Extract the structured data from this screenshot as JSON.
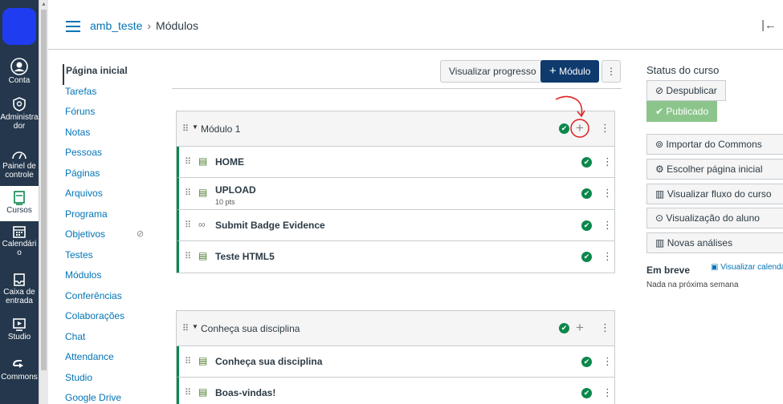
{
  "global_nav": {
    "items": [
      {
        "label": "Conta",
        "icon": "account-icon"
      },
      {
        "label": "Administrador",
        "icon": "admin-icon"
      },
      {
        "label": "Painel de controle",
        "icon": "dashboard-icon"
      },
      {
        "label": "Cursos",
        "icon": "courses-icon"
      },
      {
        "label": "Calendário",
        "icon": "calendar-icon"
      },
      {
        "label": "Caixa de entrada",
        "icon": "inbox-icon"
      },
      {
        "label": "Studio",
        "icon": "studio-icon"
      },
      {
        "label": "Commons",
        "icon": "commons-icon"
      }
    ]
  },
  "breadcrumb": {
    "course": "amb_teste",
    "current": "Módulos"
  },
  "course_nav": [
    "Página inicial",
    "Tarefas",
    "Fóruns",
    "Notas",
    "Pessoas",
    "Páginas",
    "Arquivos",
    "Programa",
    "Objetivos",
    "Testes",
    "Módulos",
    "Conferências",
    "Colaborações",
    "Chat",
    "Attendance",
    "Studio",
    "Google Drive"
  ],
  "header": {
    "progress_button": "Visualizar progresso",
    "module_button": "Módulo",
    "module_plus": "+"
  },
  "modules": [
    {
      "title": "Módulo 1",
      "items": [
        {
          "title": "HOME",
          "type": "page"
        },
        {
          "title": "UPLOAD",
          "subtitle": "10 pts",
          "type": "assignment"
        },
        {
          "title": "Submit Badge Evidence",
          "type": "link"
        },
        {
          "title": "Teste HTML5",
          "type": "page"
        }
      ]
    },
    {
      "title": "Conheça sua disciplina",
      "items": [
        {
          "title": "Conheça sua disciplina",
          "type": "page"
        },
        {
          "title": "Boas-vindas!",
          "type": "page"
        }
      ]
    }
  ],
  "sidebar": {
    "status_title": "Status do curso",
    "unpublish": "Despublicar",
    "published": "Publicado",
    "import_commons": "Importar do Commons",
    "choose_home": "Escolher página inicial",
    "course_stream": "Visualizar fluxo do curso",
    "student_view": "Visualização do aluno",
    "analytics": "Novas análises",
    "upcoming": "Em breve",
    "calendar_link": "Visualizar calendário",
    "nothing": "Nada na próxima semana"
  },
  "colors": {
    "published_green": "#0b874b",
    "link_blue": "#0374b5",
    "nav_dark": "#24374c",
    "primary_button": "#0e3a6e"
  }
}
